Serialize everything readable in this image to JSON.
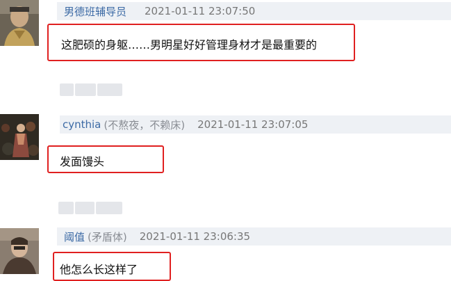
{
  "comments": [
    {
      "username": "男德班辅导员",
      "handle": "",
      "timestamp": "2021-01-11 23:07:50",
      "text": "这肥硕的身躯……男明星好好管理身材才是最重要的"
    },
    {
      "username": "cynthia",
      "handle": "(不熬夜，不赖床)",
      "timestamp": "2021-01-11 23:07:05",
      "text": "发面馒头"
    },
    {
      "username": "阈值",
      "handle": "(矛盾体)",
      "timestamp": "2021-01-11 23:06:35",
      "text": "他怎么长这样了"
    }
  ],
  "colors": {
    "highlight": "#e02020",
    "username": "#3c6aa5",
    "header_bg": "#eef1f5"
  }
}
